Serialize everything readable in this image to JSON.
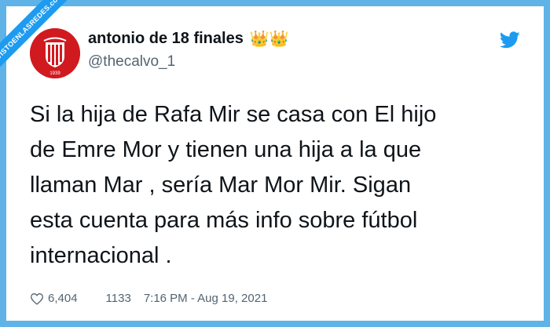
{
  "watermark": {
    "text": "VISTOENLASREDES.com"
  },
  "tweet": {
    "author": {
      "display_name": "antonio de 18 finales",
      "emoji": "👑👑",
      "handle": "@thecalvo_1",
      "avatar_year": "1939"
    },
    "text": "Si la hija de Rafa Mir se casa con El hijo\nde Emre Mor y tienen una hija a la que\nllaman Mar , sería Mar Mor Mir. Sigan\nesta cuenta para más info sobre fútbol\ninternacional .",
    "stats": {
      "likes": "6,404",
      "retweets": "1133",
      "timestamp": "7:16 PM - Aug 19, 2021"
    }
  },
  "icons": {
    "platform": "twitter-bird-icon",
    "like": "heart-icon"
  },
  "colors": {
    "frame_border": "#5fb3e6",
    "ribbon": "#1d9bf0",
    "twitter_blue": "#1d9bf0",
    "text_primary": "#0f1419",
    "text_secondary": "#536471",
    "avatar_red": "#d11a1f"
  }
}
